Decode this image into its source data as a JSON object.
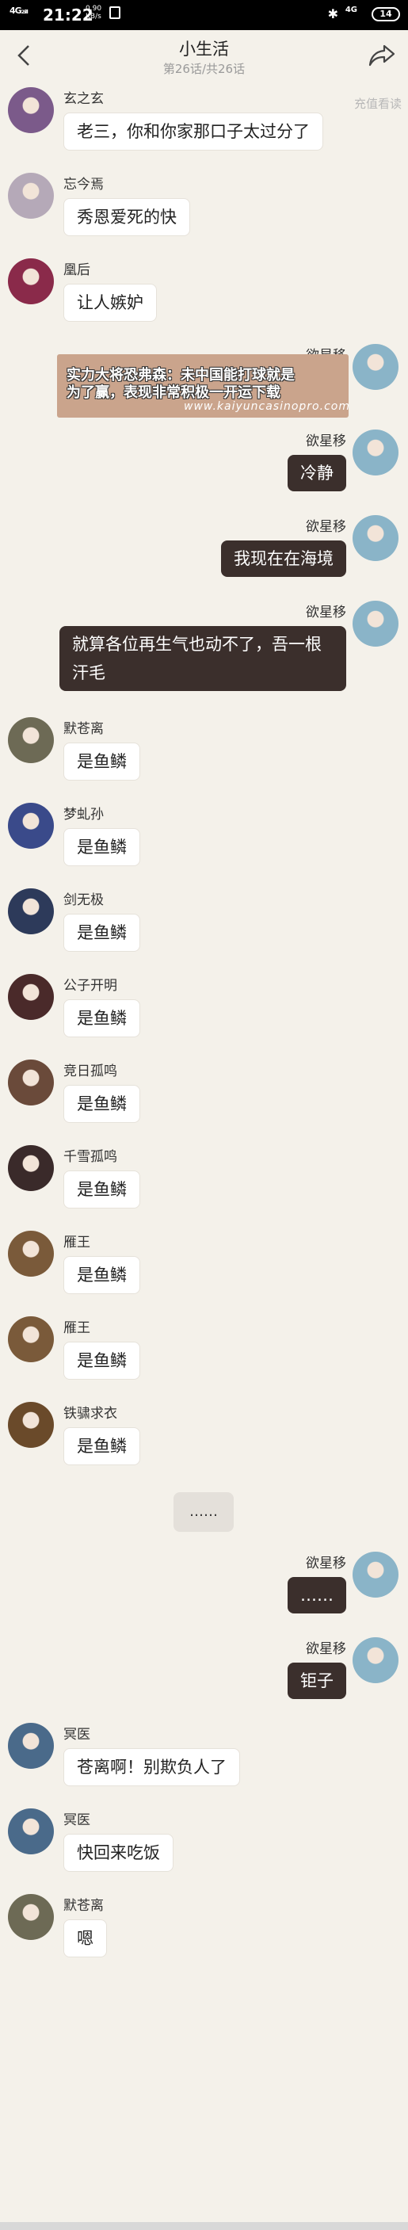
{
  "status_bar": {
    "network": "4G₂ᵢₗₗ",
    "time": "21:22",
    "speed_value": "0.90",
    "speed_unit": "KB/s",
    "bt_icon": "bluetooth-icon",
    "signal_label": "4G",
    "battery": "14"
  },
  "header": {
    "title": "小生活",
    "subtitle": "第26话/共26话",
    "notice": "充值看读"
  },
  "ad": {
    "line1": "实力大将恐弗森：未中国能打球就是",
    "line2": "为了赢，表现非常积极一开运下载",
    "url": "www.kaiyuncasinopro.com"
  },
  "messages": [
    {
      "side": "left",
      "name": "玄之玄",
      "text": "老三，你和你家那口子太过分了",
      "color": "#7b5a8a"
    },
    {
      "side": "left",
      "name": "忘今焉",
      "text": "秀恩爱死的快",
      "color": "#b5a9b8"
    },
    {
      "side": "left",
      "name": "凰后",
      "text": "让人嫉妒",
      "color": "#8a2a4a"
    },
    {
      "side": "right",
      "name": "欲星移",
      "text": "",
      "color": "#8ab4c8"
    },
    {
      "side": "right",
      "name": "欲星移",
      "text": "冷静",
      "color": "#8ab4c8"
    },
    {
      "side": "right",
      "name": "欲星移",
      "text": "我现在在海境",
      "color": "#8ab4c8"
    },
    {
      "side": "right",
      "name": "欲星移",
      "text": "就算各位再生气也动不了，吾一根汗毛",
      "color": "#8ab4c8"
    },
    {
      "side": "left",
      "name": "默苍离",
      "text": "是鱼鳞",
      "color": "#6d6a55"
    },
    {
      "side": "left",
      "name": "梦虬孙",
      "text": "是鱼鳞",
      "color": "#3a4a8a"
    },
    {
      "side": "left",
      "name": "剑无极",
      "text": "是鱼鳞",
      "color": "#2d3a5a"
    },
    {
      "side": "left",
      "name": "公子开明",
      "text": "是鱼鳞",
      "color": "#4a2a2a"
    },
    {
      "side": "left",
      "name": "竞日孤鸣",
      "text": "是鱼鳞",
      "color": "#6a4a3a"
    },
    {
      "side": "left",
      "name": "千雪孤鸣",
      "text": "是鱼鳞",
      "color": "#3a2a2a"
    },
    {
      "side": "left",
      "name": "雁王",
      "text": "是鱼鳞",
      "color": "#7a5a3a"
    },
    {
      "side": "left",
      "name": "雁王",
      "text": "是鱼鳞",
      "color": "#7a5a3a"
    },
    {
      "side": "left",
      "name": "铁骕求衣",
      "text": "是鱼鳞",
      "color": "#6a4a2a"
    },
    {
      "side": "right",
      "name": "欲星移",
      "text": "……",
      "color": "#8ab4c8"
    },
    {
      "side": "right",
      "name": "欲星移",
      "text": "钜子",
      "color": "#8ab4c8"
    },
    {
      "side": "left",
      "name": "冥医",
      "text": "苍离啊！别欺负人了",
      "color": "#4a6a8a"
    },
    {
      "side": "left",
      "name": "冥医",
      "text": "快回来吃饭",
      "color": "#4a6a8a"
    },
    {
      "side": "left",
      "name": "默苍离",
      "text": "嗯",
      "color": "#6d6a55"
    }
  ],
  "separator": "……"
}
